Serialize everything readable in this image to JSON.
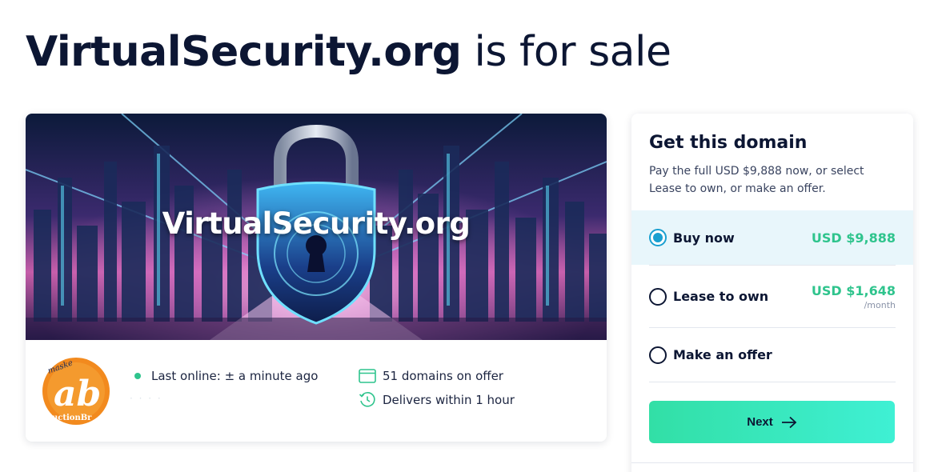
{
  "headline": {
    "domain": "VirtualSecurity.org",
    "rest": " is for sale"
  },
  "hero": {
    "title": "VirtualSecurity.org"
  },
  "seller": {
    "last_online": "Last online: ± a minute ago",
    "faint_line": "· · · ·",
    "domains_on_offer": "51 domains on offer",
    "delivery": "Delivers within 1 hour",
    "logo_text_top": "maske",
    "logo_text_main": "ab",
    "logo_text_bottom": "uctionBr",
    "online_color": "#2fc48d"
  },
  "panel": {
    "title": "Get this domain",
    "description": "Pay the full USD $9,888 now, or select Lease to own, or make an offer.",
    "options": [
      {
        "label": "Buy now",
        "price": "USD $9,888",
        "suffix": "",
        "selected": true
      },
      {
        "label": "Lease to own",
        "price": "USD $1,648",
        "suffix": "/month",
        "selected": false
      },
      {
        "label": "Make an offer",
        "price": "",
        "suffix": "",
        "selected": false
      }
    ],
    "next_label": "Next"
  },
  "colors": {
    "accent_green": "#2fc48d",
    "selected_bg": "#e8f6fb",
    "radio_blue": "#1a9fd0",
    "navy": "#0c1633"
  }
}
